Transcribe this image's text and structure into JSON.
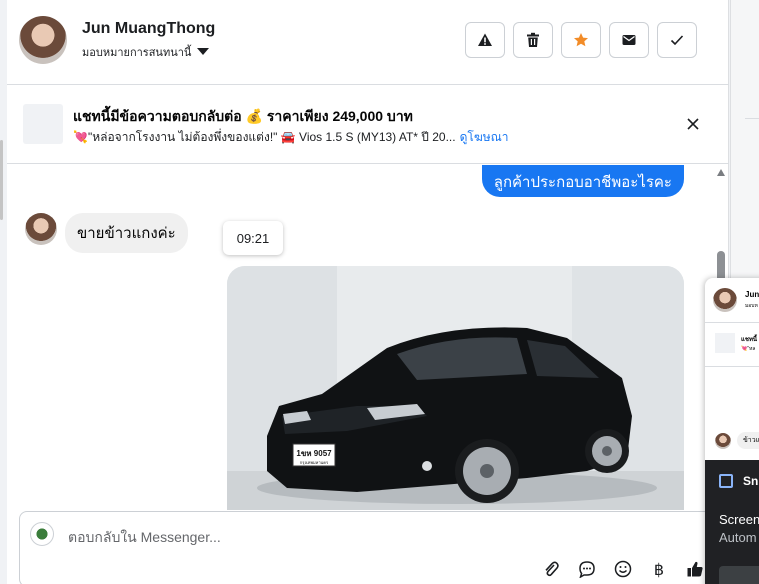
{
  "header": {
    "contact_name": "Jun MuangThong",
    "assign_label": "มอบหมายการสนทนานี้",
    "actions": [
      {
        "name": "report-button",
        "icon": "warning-icon"
      },
      {
        "name": "delete-button",
        "icon": "trash-icon"
      },
      {
        "name": "star-button",
        "icon": "star-icon",
        "color": "#f28c28"
      },
      {
        "name": "mark-unread-button",
        "icon": "envelope-icon"
      },
      {
        "name": "mark-done-button",
        "icon": "check-icon"
      }
    ]
  },
  "ad": {
    "title": "แชทนี้มีข้อความตอบกลับต่อ 💰 ราคาเพียง 249,000 บาท",
    "subtitle": "💘\"หล่อจากโรงงาน ไม่ต้องพึ่งของแต่ง!\" 🚘 Vios 1.5 S (MY13) AT* ปี 20...",
    "link": "ดูโฆษณา"
  },
  "chat": {
    "outgoing_text": "ลูกค้าประกอบอาชีพอะไรคะ",
    "incoming_text": "ขายข้าวแกงค่ะ",
    "timestamp": "09:21",
    "photo": {
      "plate": "1ขห 9057",
      "plate_sub": "กรุงเทพมหานคร"
    }
  },
  "composer": {
    "placeholder": "ตอบกลับใน Messenger...",
    "tools": [
      "paperclip-icon",
      "chat-bubble-icon",
      "emoji-icon",
      "baht-icon",
      "thumbs-up-icon"
    ]
  },
  "mini_window": {
    "name": "Jun",
    "sub": "มอบห",
    "ad": "แชทนี้",
    "ad_sub": "💘\"หล",
    "bubble": "ข้าวแ"
  },
  "toast": {
    "app": "Snip",
    "line1": "Screen",
    "line2": "Autom"
  },
  "colors": {
    "accent": "#1877f2",
    "star": "#f28c28"
  }
}
